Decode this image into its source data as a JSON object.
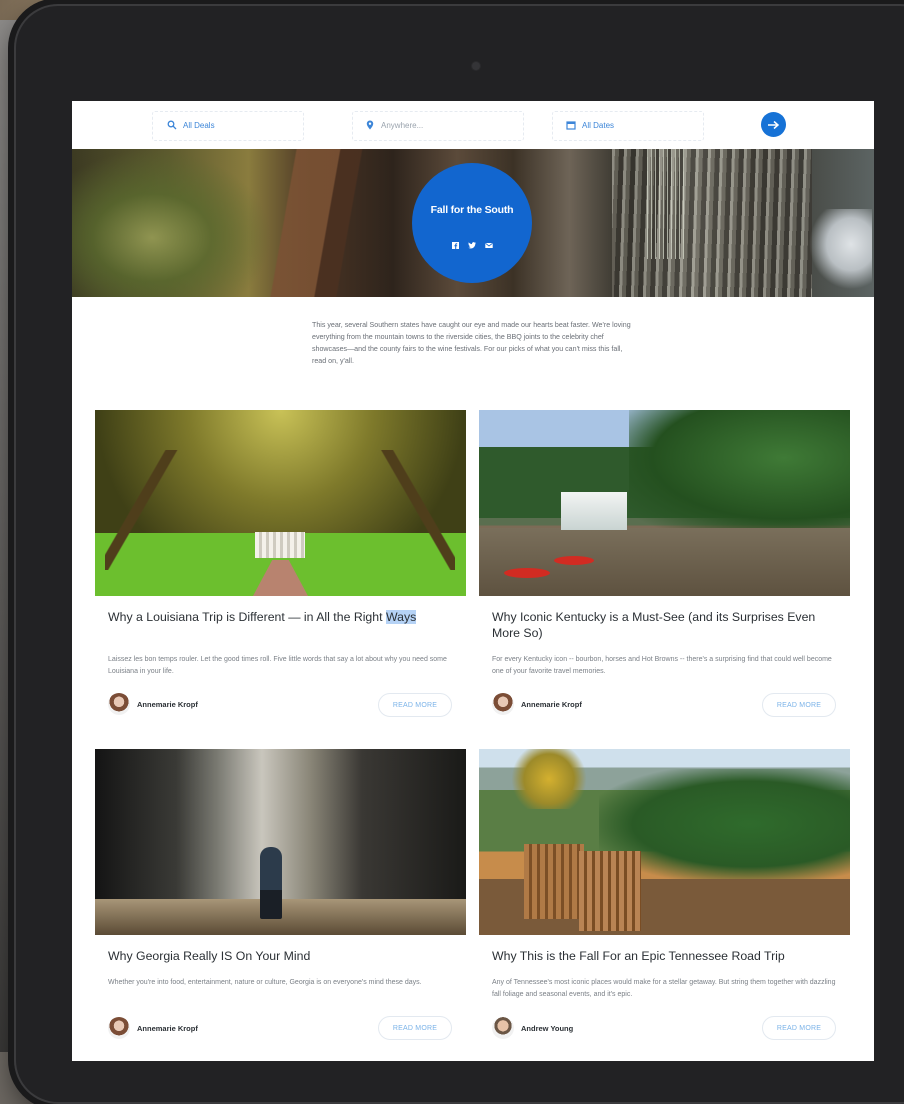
{
  "search": {
    "deals_label": "All Deals",
    "location_placeholder": "Anywhere...",
    "dates_label": "All Dates"
  },
  "hero": {
    "title": "Fall for the South",
    "social_icons": [
      "facebook-icon",
      "twitter-icon",
      "email-icon"
    ]
  },
  "intro": "This year, several Southern states have caught our eye and made our hearts beat faster. We're loving everything from the mountain towns to the riverside cities, the BBQ joints to the celebrity chef showcases—and the county fairs to the wine festivals. For our picks of what you can't miss this fall, read on, y'all.",
  "articles": [
    {
      "title": "Why a Louisiana Trip is Different — in All the Right",
      "title_highlight": "Ways",
      "excerpt": "Laissez les bon temps rouler. Let the good times roll. Five little words that say a lot about why you need some Louisiana in your life.",
      "author": "Annemarie Kropf",
      "cta": "READ MORE"
    },
    {
      "title": "Why Iconic Kentucky is a Must-See (and its Surprises Even More So)",
      "excerpt": "For every Kentucky icon -- bourbon, horses and Hot Browns -- there's a surprising find that could well become one of your favorite travel memories.",
      "author": "Annemarie Kropf",
      "cta": "READ MORE"
    },
    {
      "title": "Why Georgia Really IS On Your Mind",
      "excerpt": "Whether you're into food, entertainment, nature or culture, Georgia is on everyone's mind these days.",
      "author": "Annemarie Kropf",
      "cta": "READ MORE"
    },
    {
      "title": "Why This is the Fall For an Epic Tennessee Road Trip",
      "excerpt": "Any of Tennessee's most iconic places would make for a stellar getaway. But string them together with dazzling fall foliage and seasonal events, and it's epic.",
      "author": "Andrew Young",
      "cta": "READ MORE"
    }
  ],
  "colors": {
    "accent": "#1266cf",
    "link": "#3d86d8",
    "text": "#2b3035"
  }
}
